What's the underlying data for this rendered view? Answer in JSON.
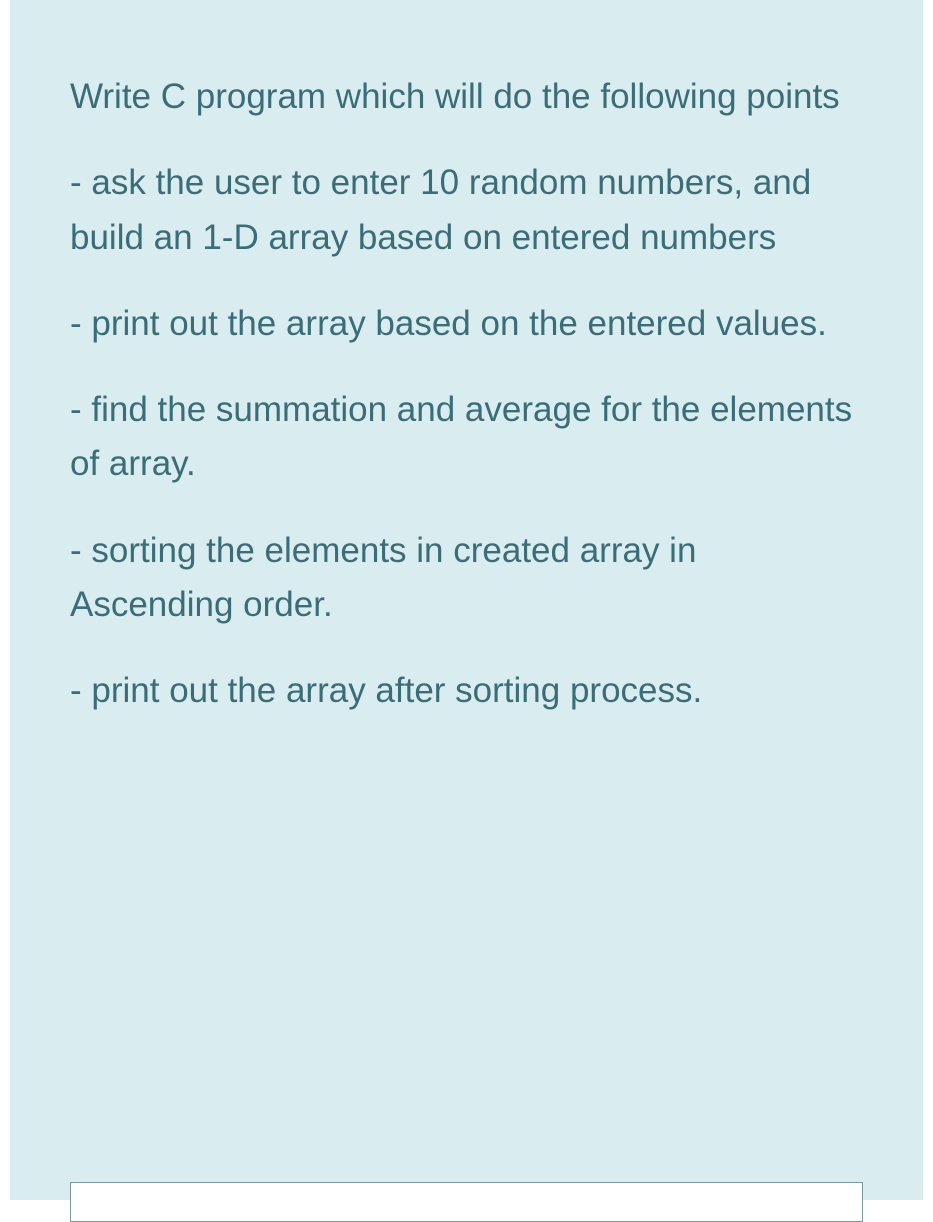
{
  "paragraphs": [
    "Write C program which will do the following points",
    "- ask the user to enter 10 random numbers, and build an 1-D array based on entered numbers",
    "- print out the array based on the entered values.",
    "- find the summation and average for the elements of array.",
    "- sorting the elements in created array in Ascending order.",
    "- print out the array after sorting process."
  ],
  "input": {
    "value": "",
    "placeholder": ""
  }
}
